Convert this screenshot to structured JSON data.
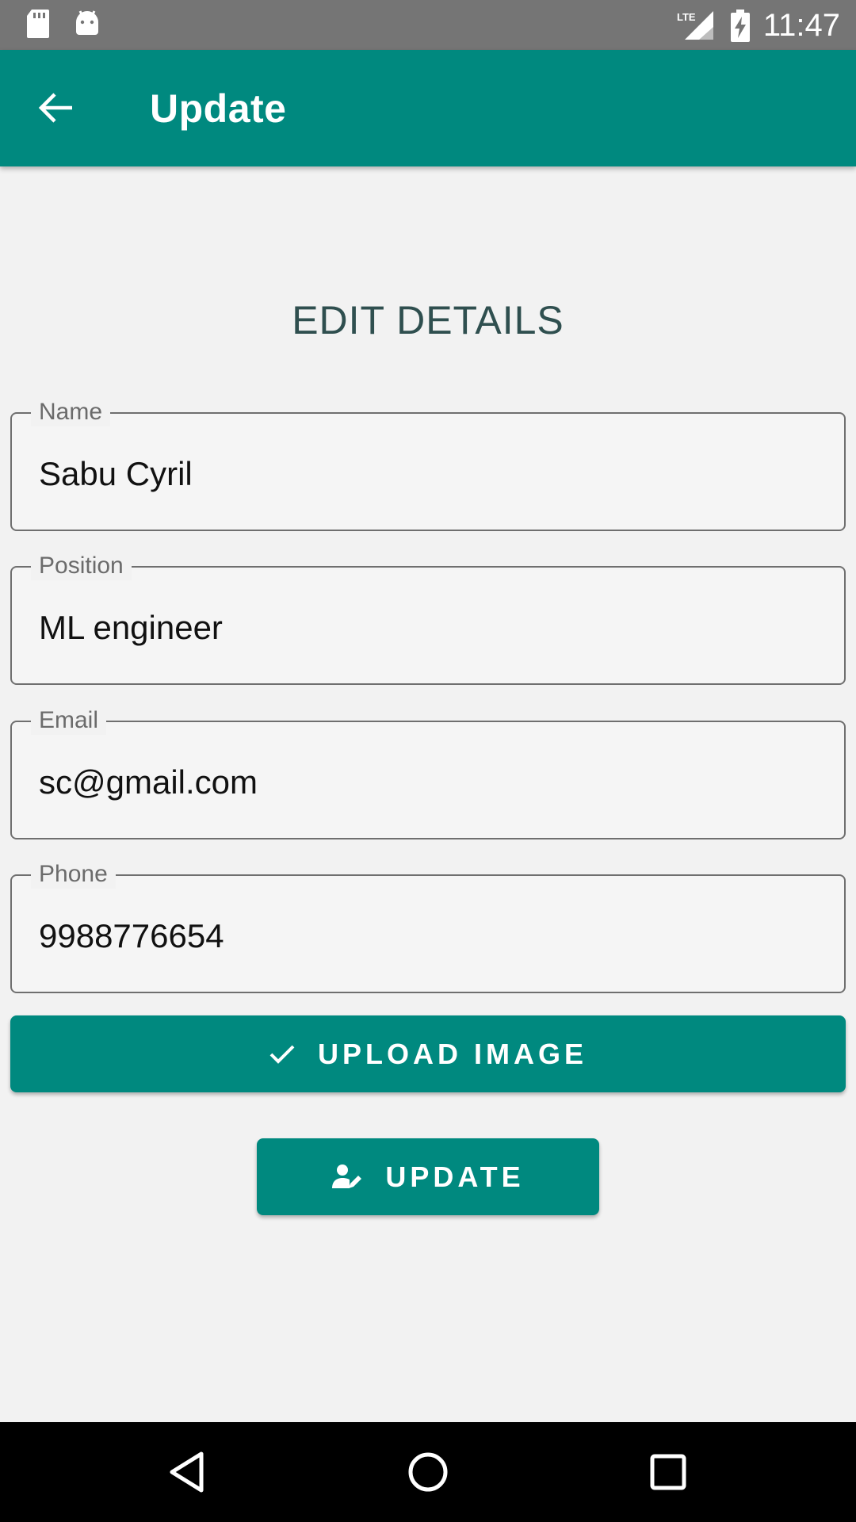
{
  "status_bar": {
    "time": "11:47",
    "network": "LTE",
    "icons": [
      "sd-card-icon",
      "android-icon",
      "lte-signal-icon",
      "battery-charging-icon"
    ]
  },
  "app_bar": {
    "title": "Update",
    "back_icon": "arrow-back-icon"
  },
  "form": {
    "heading": "EDIT DETAILS",
    "fields": [
      {
        "label": "Name",
        "value": "Sabu Cyril"
      },
      {
        "label": "Position",
        "value": "ML engineer"
      },
      {
        "label": "Email",
        "value": "sc@gmail.com"
      },
      {
        "label": "Phone",
        "value": "9988776654"
      }
    ],
    "upload_button": {
      "label": "UPLOAD IMAGE",
      "icon": "check-icon"
    },
    "update_button": {
      "label": "UPDATE",
      "icon": "person-edit-icon"
    }
  },
  "nav_bar": {
    "icons": [
      "back-triangle-icon",
      "home-circle-icon",
      "recents-square-icon"
    ]
  },
  "colors": {
    "primary": "#00897f",
    "status_bar": "#757575",
    "background": "#f2f2f2",
    "heading": "#2f4f4f"
  }
}
